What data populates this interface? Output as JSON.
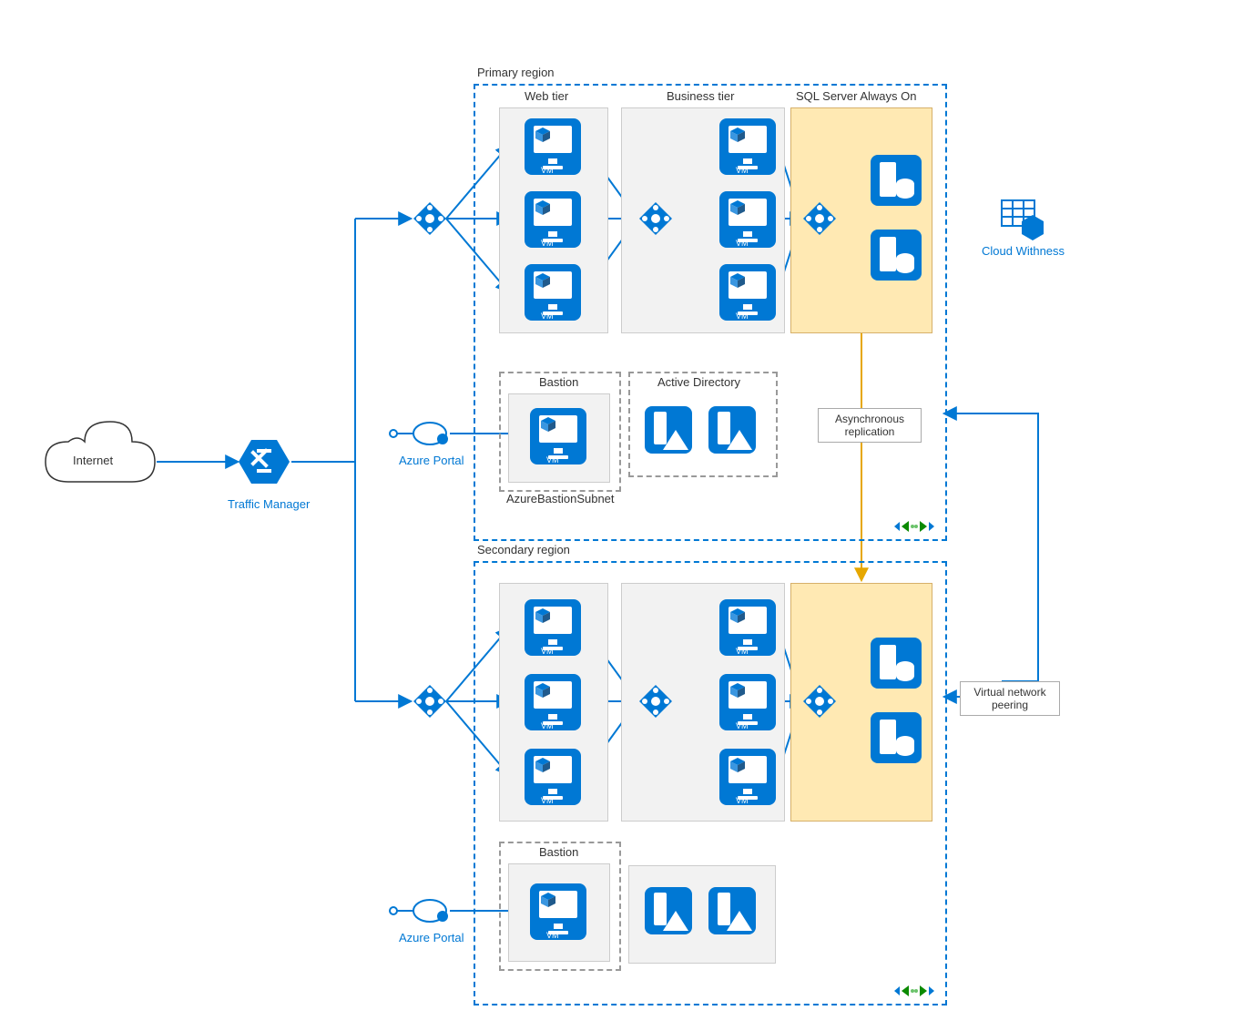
{
  "internet_label": "Internet",
  "traffic_manager_label": "Traffic Manager",
  "azure_portal_label": "Azure Portal",
  "primary_region_label": "Primary region",
  "secondary_region_label": "Secondary region",
  "web_tier_label": "Web tier",
  "business_tier_label": "Business tier",
  "sql_always_on_label": "SQL Server Always On",
  "bastion_label": "Bastion",
  "azure_bastion_subnet_label": "AzureBastionSubnet",
  "active_directory_label": "Active Directory",
  "async_replication_label": "Asynchronous replication",
  "cloud_witness_label": "Cloud Withness",
  "vnet_peering_label": "Virtual network peering",
  "vm_caption": "VM",
  "colors": {
    "accent": "#0078d4",
    "amber": "#ffe9b3",
    "arrow_amber": "#e6a700"
  }
}
